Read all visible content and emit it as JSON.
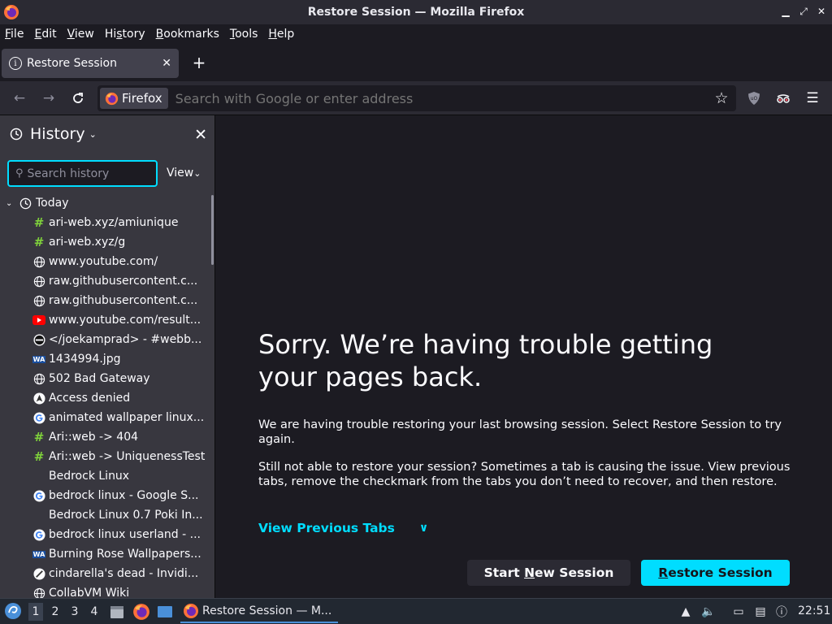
{
  "window": {
    "title": "Restore Session — Mozilla Firefox"
  },
  "menu": [
    {
      "label": "File",
      "mnemonic": "F",
      "rest": "ile"
    },
    {
      "label": "Edit",
      "mnemonic": "E",
      "rest": "dit"
    },
    {
      "label": "View",
      "mnemonic": "V",
      "rest": "iew"
    },
    {
      "label": "History",
      "mnemonic": "s",
      "pre": "Hi",
      "rest": "tory"
    },
    {
      "label": "Bookmarks",
      "mnemonic": "B",
      "rest": "ookmarks"
    },
    {
      "label": "Tools",
      "mnemonic": "T",
      "rest": "ools"
    },
    {
      "label": "Help",
      "mnemonic": "H",
      "rest": "elp"
    }
  ],
  "tab": {
    "label": "Restore Session"
  },
  "urlbar": {
    "identity_label": "Firefox",
    "placeholder": "Search with Google or enter address"
  },
  "sidebar": {
    "title": "History",
    "search_placeholder": "Search history",
    "view_label": "View",
    "group_label": "Today",
    "items": [
      {
        "label": "ari-web.xyz/amiunique",
        "icon": "hash-icon"
      },
      {
        "label": "ari-web.xyz/g",
        "icon": "hash-icon"
      },
      {
        "label": "www.youtube.com/",
        "icon": "globe-icon"
      },
      {
        "label": "raw.githubusercontent.c...",
        "icon": "globe-icon"
      },
      {
        "label": "raw.githubusercontent.c...",
        "icon": "globe-icon"
      },
      {
        "label": "www.youtube.com/result...",
        "icon": "youtube-icon"
      },
      {
        "label": "</joekamprad> - #webb...",
        "icon": "dark-circle-icon"
      },
      {
        "label": "1434994.jpg",
        "icon": "wa-icon"
      },
      {
        "label": "502 Bad Gateway",
        "icon": "globe-icon"
      },
      {
        "label": "Access denied",
        "icon": "arch-icon"
      },
      {
        "label": "animated wallpaper linux...",
        "icon": "google-icon"
      },
      {
        "label": "Ari::web -> 404",
        "icon": "hash-icon"
      },
      {
        "label": "Ari::web -> UniquenessTest",
        "icon": "hash-icon"
      },
      {
        "label": "Bedrock Linux",
        "icon": "blank-icon"
      },
      {
        "label": "bedrock linux - Google S...",
        "icon": "google-icon"
      },
      {
        "label": "Bedrock Linux 0.7 Poki In...",
        "icon": "blank-icon"
      },
      {
        "label": "bedrock linux userland - ...",
        "icon": "google-icon"
      },
      {
        "label": "Burning Rose Wallpapers...",
        "icon": "wa-icon"
      },
      {
        "label": "cindarella's dead - Invidi...",
        "icon": "invidious-icon"
      },
      {
        "label": "CollabVM Wiki",
        "icon": "globe-icon"
      }
    ]
  },
  "content": {
    "heading": "Sorry. We’re having trouble getting your pages back.",
    "p1": "We are having trouble restoring your last browsing session. Select Restore Session to try again.",
    "p2": "Still not able to restore your session? Sometimes a tab is causing the issue. View previous tabs, remove the checkmark from the tabs you don’t need to recover, and then restore.",
    "view_previous": "View Previous Tabs",
    "start_new_pre": "Start ",
    "start_new_mnemonic": "N",
    "start_new_post": "ew Session",
    "restore_mnemonic": "R",
    "restore_post": "estore Session"
  },
  "taskbar": {
    "workspaces": [
      "1",
      "2",
      "3",
      "4"
    ],
    "task_label": "Restore Session — M...",
    "clock": "22:51"
  },
  "colors": {
    "accent": "#00ddff",
    "background": "#1c1b22",
    "sidebar": "#38373f",
    "toolbar": "#2b2a33"
  }
}
